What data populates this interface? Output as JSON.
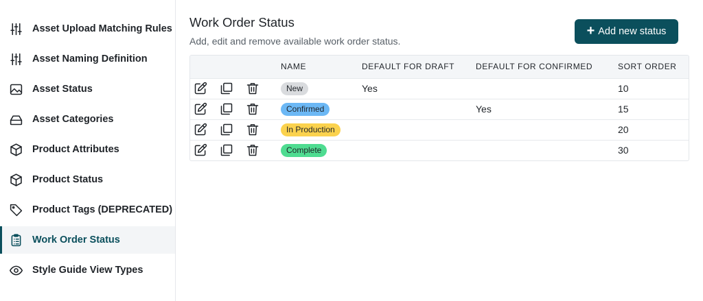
{
  "sidebar": {
    "items": [
      {
        "label": "Asset Upload Matching Rules",
        "icon": "sliders-icon"
      },
      {
        "label": "Asset Naming Definition",
        "icon": "sliders-icon"
      },
      {
        "label": "Asset Status",
        "icon": "image-icon"
      },
      {
        "label": "Asset Categories",
        "icon": "inbox-icon"
      },
      {
        "label": "Product Attributes",
        "icon": "box-icon"
      },
      {
        "label": "Product Status",
        "icon": "box-icon"
      },
      {
        "label": "Product Tags (DEPRECATED)",
        "icon": "tag-icon"
      },
      {
        "label": "Work Order Status",
        "icon": "clipboard-list-icon",
        "active": true
      },
      {
        "label": "Style Guide View Types",
        "icon": "eye-icon"
      }
    ]
  },
  "header": {
    "title": "Work Order Status",
    "subtitle": "Add, edit and remove available work order status.",
    "add_button_label": "Add new status"
  },
  "table": {
    "columns": [
      "",
      "NAME",
      "DEFAULT FOR DRAFT",
      "DEFAULT FOR CONFIRMED",
      "SORT ORDER"
    ],
    "rows": [
      {
        "name": "New",
        "badge_color": "#d9dbde",
        "default_draft": "Yes",
        "default_confirmed": "",
        "sort_order": "10"
      },
      {
        "name": "Confirmed",
        "badge_color": "#6cb8f5",
        "default_draft": "",
        "default_confirmed": "Yes",
        "sort_order": "15"
      },
      {
        "name": "In Production",
        "badge_color": "#fbd24e",
        "default_draft": "",
        "default_confirmed": "",
        "sort_order": "20"
      },
      {
        "name": "Complete",
        "badge_color": "#4fdc91",
        "default_draft": "",
        "default_confirmed": "",
        "sort_order": "30"
      }
    ]
  },
  "colors": {
    "accent": "#0b4f5c"
  }
}
